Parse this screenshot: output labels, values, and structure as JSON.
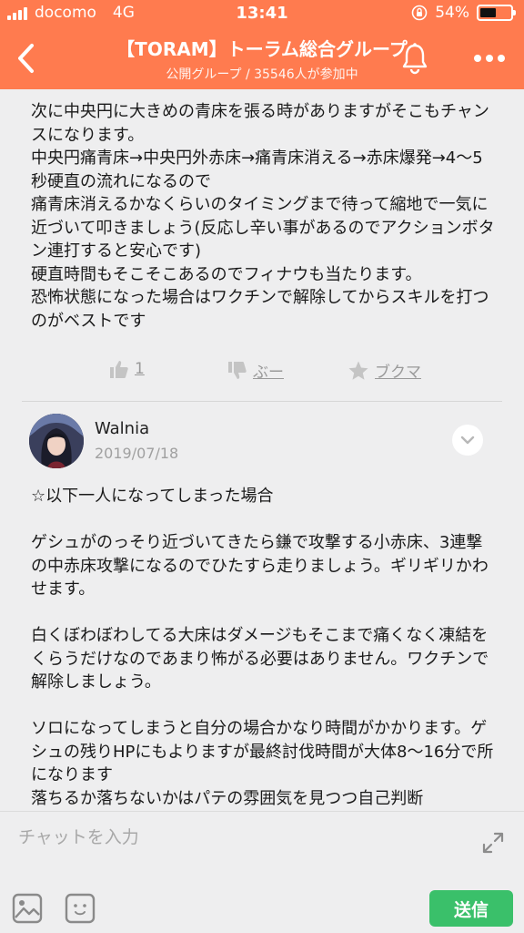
{
  "status_bar": {
    "carrier": "docomo",
    "network": "4G",
    "time": "13:41",
    "battery": "54%",
    "battery_level": 0.54
  },
  "header": {
    "title": "【TORAM】トーラム総合グループ",
    "subtitle": "公開グループ / 35546人が参加中",
    "back_icon": "chevron-left-icon",
    "bell_icon": "bell-icon",
    "more_icon": "more-horizontal-icon"
  },
  "post1": {
    "text": "次に中央円に大きめの青床を張る時がありますがそこもチャンスになります。\n中央円痛青床→中央円外赤床→痛青床消える→赤床爆発→4〜5秒硬直の流れになるので\n痛青床消えるかなくらいのタイミングまで待って縮地で一気に近づいて叩きましょう(反応し辛い事があるのでアクションボタン連打すると安心です)\n硬直時間もそこそこあるのでフィナウも当たります。\n恐怖状態になった場合はワクチンで解除してからスキルを打つのがベストです"
  },
  "actions": {
    "like_count": "1",
    "boo_label": "ぶー",
    "bookmark_label": "ブクマ"
  },
  "comment": {
    "author": "Walnia",
    "date": "2019/07/18",
    "text": "☆以下一人になってしまった場合\n\nゲシュがのっそり近づいてきたら鎌で攻撃する小赤床、3連撃の中赤床攻撃になるのでひたすら走りましょう。ギリギリかわせます。\n\n白くぼわぼわしてる大床はダメージもそこまで痛くなく凍結をくらうだけなのであまり怖がる必要はありません。ワクチンで解除しましょう。\n\nソロになってしまうと自分の場合かなり時間がかかります。ゲシュの残りHPにもよりますが最終討伐時間が大体8〜16分で所になります\n落ちるか落ちないかはパテの雰囲気を見つつ自己判断"
  },
  "input": {
    "placeholder": "チャットを入力",
    "send_label": "送信"
  },
  "colors": {
    "header": "#ff7b4f",
    "send": "#3ac06a",
    "background": "#eeeeef"
  }
}
